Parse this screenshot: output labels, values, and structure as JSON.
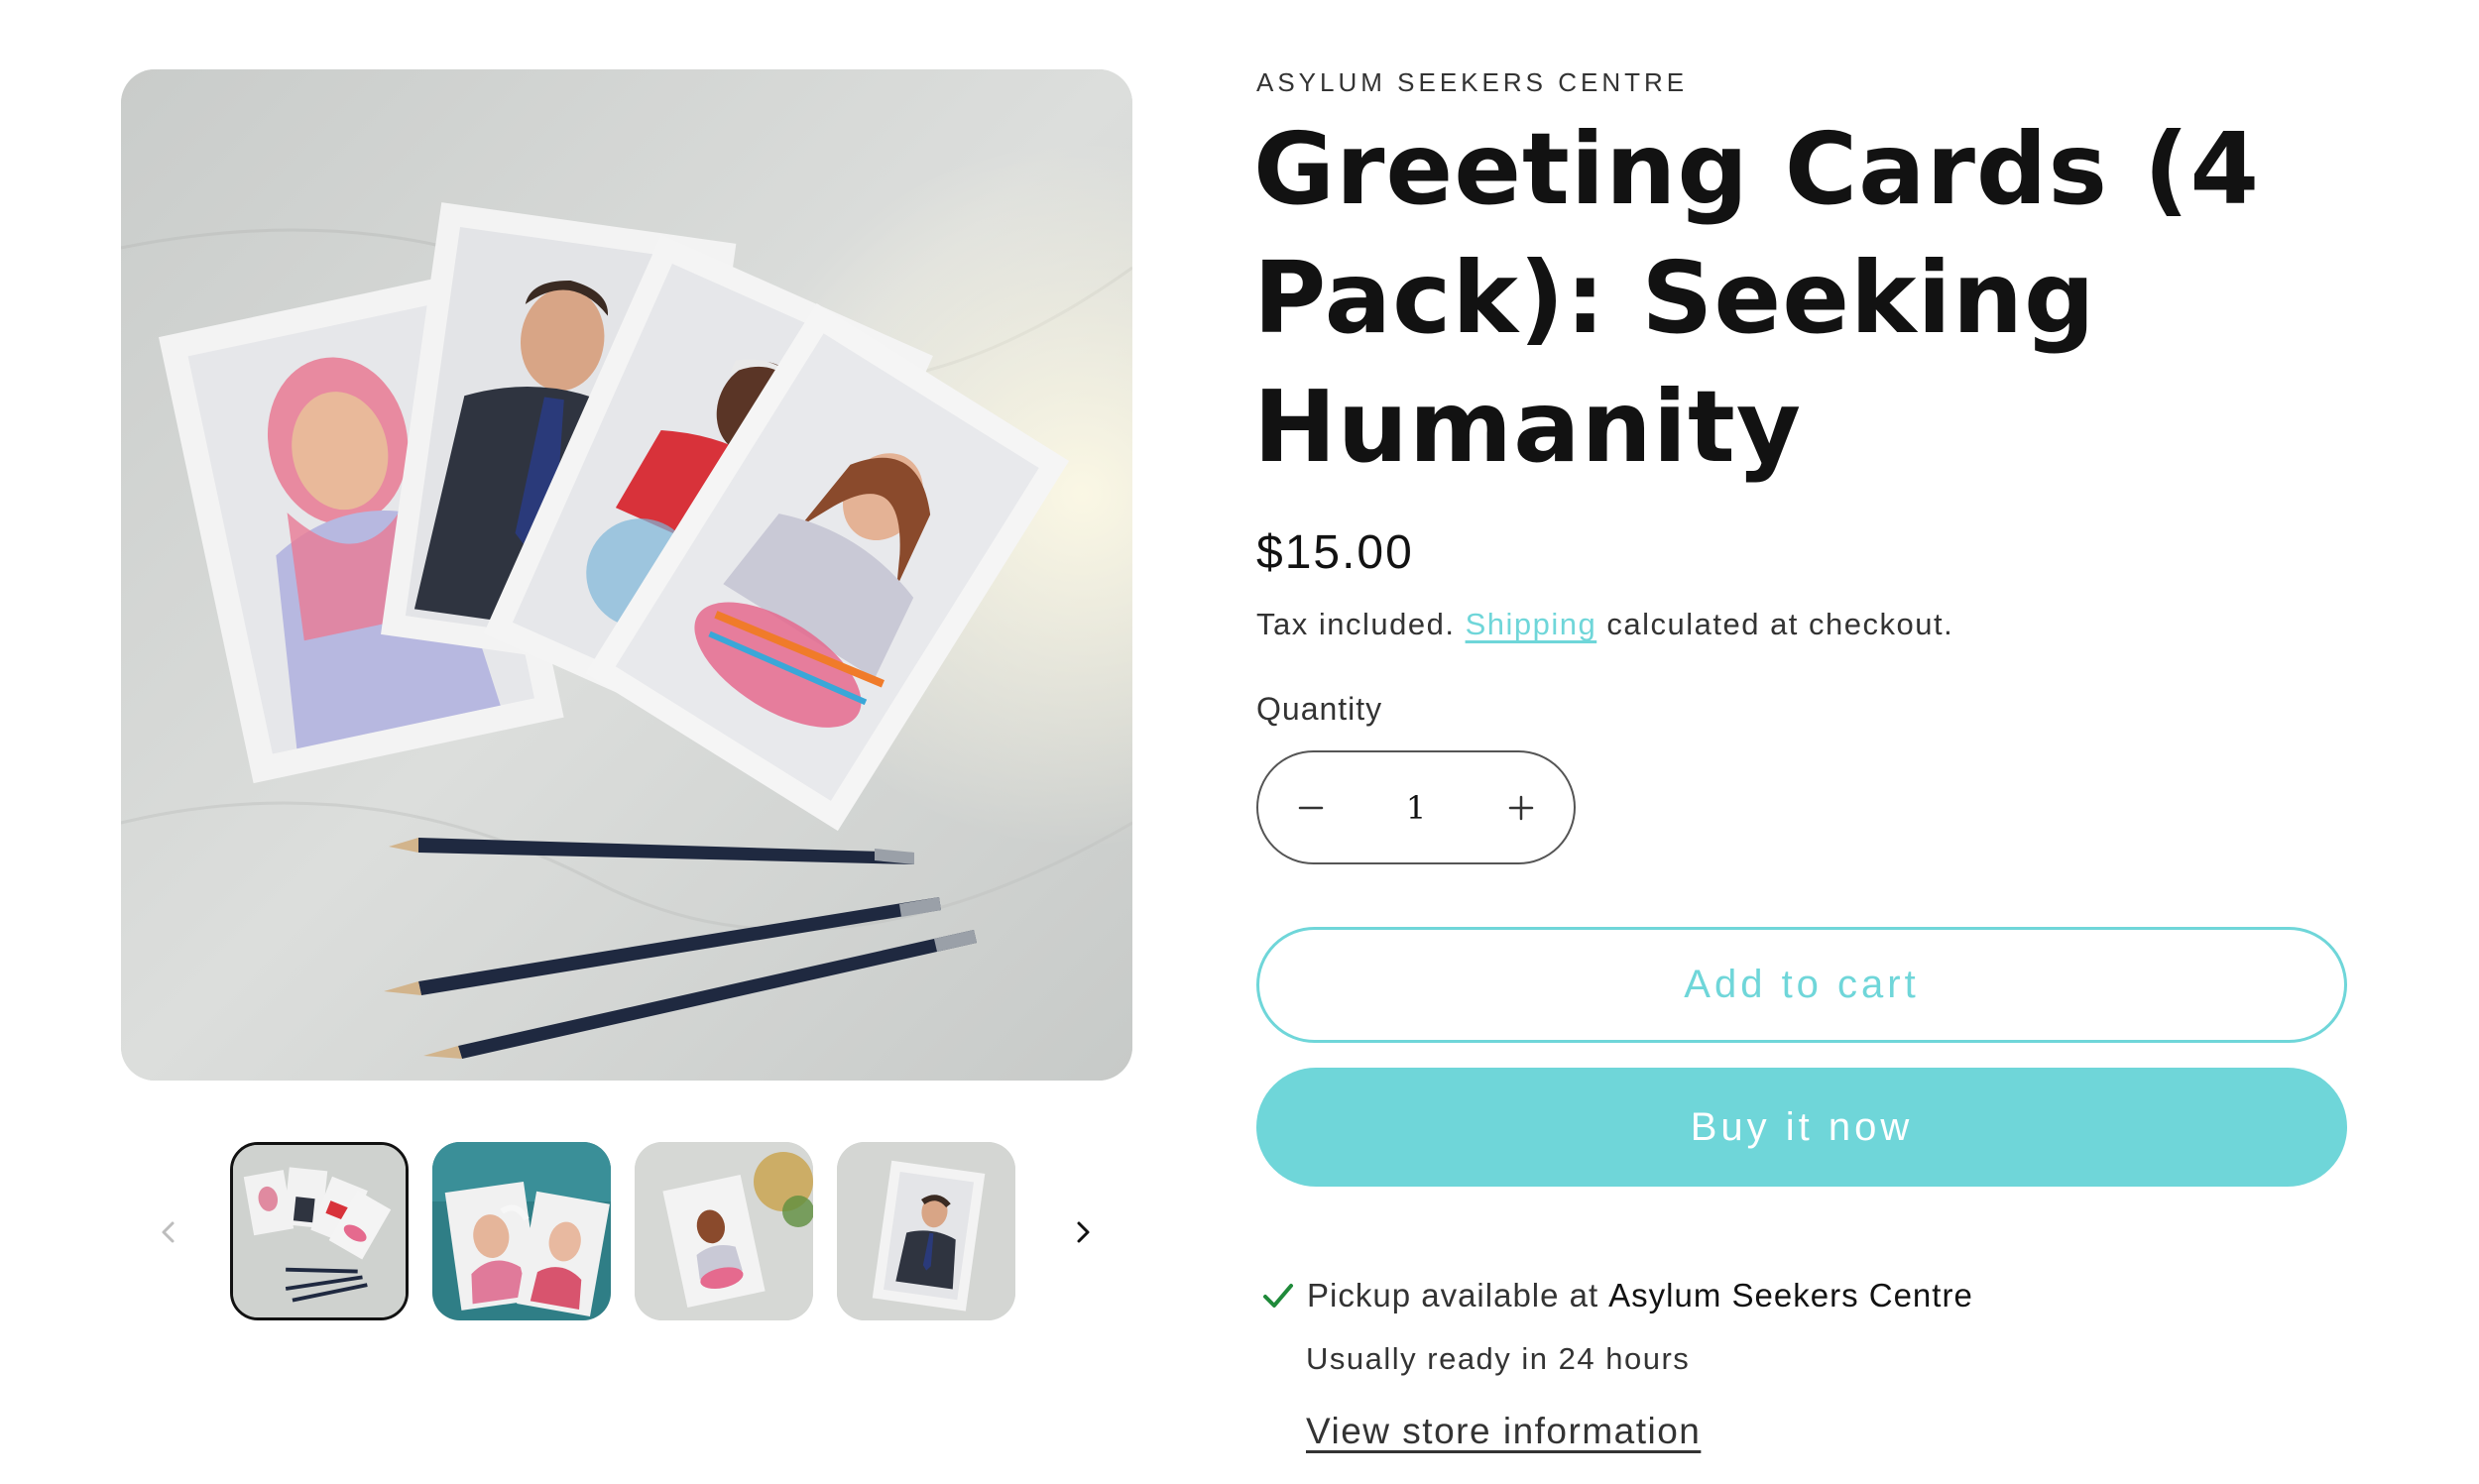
{
  "product": {
    "vendor": "ASYLUM SEEKERS CENTRE",
    "title": "Greeting Cards (4 Pack): Seeking Humanity",
    "price": "$15.00",
    "tax_prefix": "Tax included.",
    "shipping_link": "Shipping",
    "tax_suffix": "calculated at checkout."
  },
  "quantity": {
    "label": "Quantity",
    "value": "1",
    "decrease_icon": "minus-icon",
    "increase_icon": "plus-icon"
  },
  "buttons": {
    "add_to_cart": "Add to cart",
    "buy_now": "Buy it now"
  },
  "pickup": {
    "prefix": "Pickup available at",
    "store": "Asylum Seekers Centre",
    "ready": "Usually ready in 24 hours",
    "link": "View store information",
    "icon": "checkmark-icon"
  },
  "gallery": {
    "thumbnail_count": 4,
    "active_thumbnail": 1,
    "prev_icon": "chevron-left-icon",
    "next_icon": "chevron-right-icon"
  },
  "colors": {
    "accent": "#6fd6d9",
    "text": "#121212",
    "check": "#1f8a3a"
  }
}
